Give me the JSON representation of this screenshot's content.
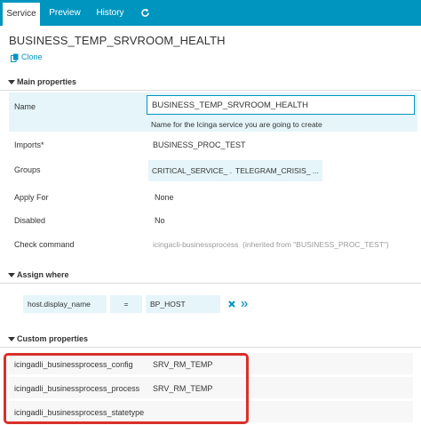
{
  "tabs": [
    {
      "label": "Service"
    },
    {
      "label": "Preview"
    },
    {
      "label": "History"
    }
  ],
  "icons": {
    "refresh": "refresh-icon",
    "clone": "clone-icon",
    "remove": "remove-x-icon",
    "expand": "double-chevron-right-icon"
  },
  "colors": {
    "accent": "#0095bf",
    "highlight_row": "#e6f5fa",
    "annotation_box": "#d9302a"
  },
  "page": {
    "title": "BUSINESS_TEMP_SRVROOM_HEALTH",
    "clone_label": "Clone"
  },
  "main_properties": {
    "heading": "Main properties",
    "name_label": "Name",
    "name_value": "BUSINESS_TEMP_SRVROOM_HEALTH",
    "name_hint": "Name for the Icinga service you are going to create",
    "imports_label": "Imports*",
    "imports_value": "BUSINESS_PROC_TEST",
    "groups_label": "Groups",
    "groups": [
      "CRITICAL_SERVICE_ ...",
      "TELEGRAM_CRISIS_ ..."
    ],
    "apply_for_label": "Apply For",
    "apply_for_value": "None",
    "disabled_label": "Disabled",
    "disabled_value": "No",
    "check_command_label": "Check command",
    "check_command_value": "icingacli-businessprocess",
    "check_command_inherited": "(inherited from \"BUSINESS_PROC_TEST\")"
  },
  "assign_where": {
    "heading": "Assign where",
    "column": "host.display_name",
    "operator": "=",
    "value": "BP_HOST"
  },
  "custom_properties": {
    "heading": "Custom properties",
    "rows": [
      {
        "label": "icingadli_businessprocess_config",
        "value": "SRV_RM_TEMP"
      },
      {
        "label": "icingadli_businessprocess_process",
        "value": "SRV_RM_TEMP"
      },
      {
        "label": "icingadli_businessprocess_statetype",
        "value": ""
      }
    ]
  }
}
